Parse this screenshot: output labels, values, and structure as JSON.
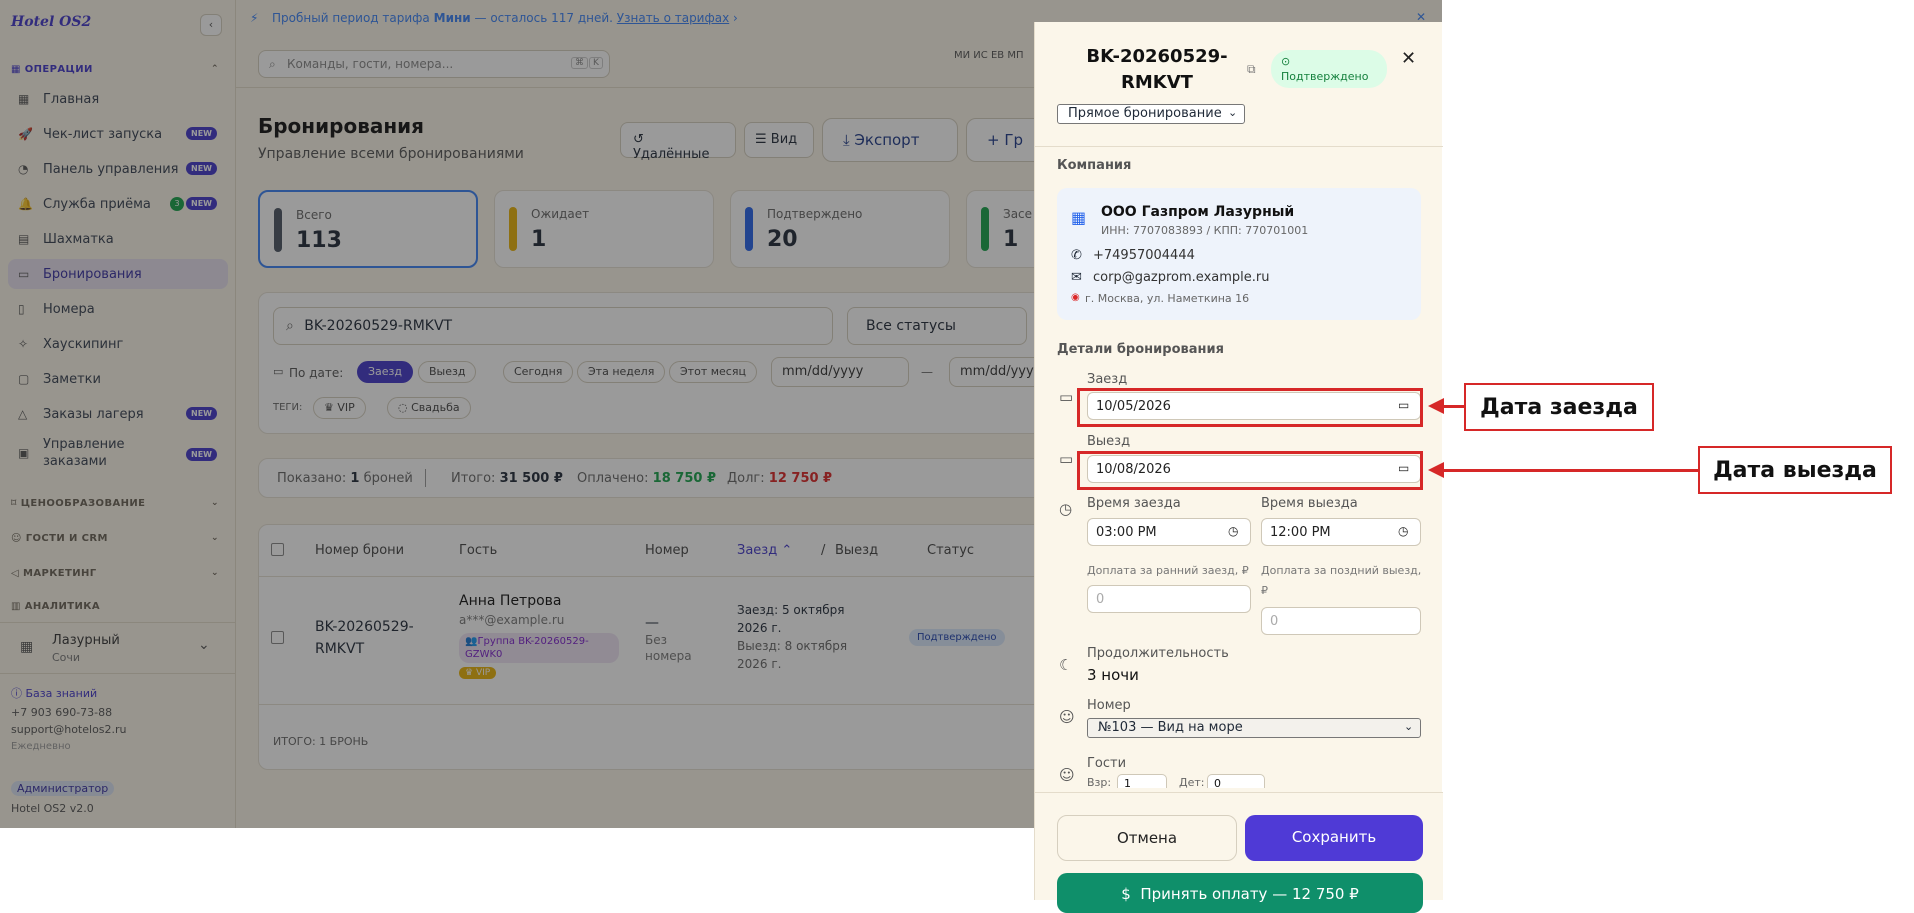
{
  "brand": "Hotel OS2",
  "trial": {
    "text_pre": "Пробный период тарифа",
    "plan": "Мини",
    "text_post": "— осталось 117 дней.",
    "link": "Узнать о тарифах"
  },
  "search": {
    "placeholder": "Команды, гости, номера...",
    "kbd1": "⌘",
    "kbd2": "K"
  },
  "avatars": [
    "МИ",
    "ИС",
    "ЕВ",
    "МП"
  ],
  "sidebar": {
    "section_ops": "ОПЕРАЦИИ",
    "items": [
      {
        "label": "Главная",
        "icon": "grid-icon"
      },
      {
        "label": "Чек-лист запуска",
        "icon": "rocket-icon",
        "new": "NEW"
      },
      {
        "label": "Панель управления",
        "icon": "gauge-icon",
        "new": "NEW"
      },
      {
        "label": "Служба приёма",
        "icon": "bell-icon",
        "count": "3",
        "new": "NEW"
      },
      {
        "label": "Шахматка",
        "icon": "table-icon"
      },
      {
        "label": "Бронирования",
        "icon": "calendar-icon"
      },
      {
        "label": "Номера",
        "icon": "door-icon"
      },
      {
        "label": "Хаускипинг",
        "icon": "sparkle-icon"
      },
      {
        "label": "Заметки",
        "icon": "note-icon"
      },
      {
        "label": "Заказы лагеря",
        "icon": "tent-icon",
        "new": "NEW"
      },
      {
        "label": "Управление",
        "label2": "заказами",
        "icon": "orders-icon",
        "new": "NEW"
      }
    ],
    "section_pricing": "ЦЕНООБРАЗОВАНИЕ",
    "section_guests": "ГОСТИ И CRM",
    "section_marketing": "МАРКЕТИНГ",
    "section_analytics": "АНАЛИТИКА",
    "hotel_name": "Лазурный",
    "hotel_city": "Сочи",
    "kb": "База знаний",
    "phone": "+7 903 690-73-88",
    "email": "support@hotelos2.ru",
    "daily": "Ежедневно",
    "role": "Администратор",
    "version": "Hotel OS2 v2.0"
  },
  "page": {
    "title": "Бронирования",
    "subtitle": "Управление всеми бронированиями",
    "btn_deleted": "Удалённые",
    "btn_view": "Вид",
    "btn_export": "Экспорт",
    "btn_group": "Гр"
  },
  "stats": [
    {
      "label": "Всего",
      "value": "113",
      "color": "#4b5563"
    },
    {
      "label": "Ожидает",
      "value": "1",
      "color": "#eab308"
    },
    {
      "label": "Подтверждено",
      "value": "20",
      "color": "#2563eb"
    },
    {
      "label": "Засе",
      "value": "1",
      "color": "#16a34a"
    }
  ],
  "filters": {
    "search_value": "BK-20260529-RMKVT",
    "status": "Все статусы",
    "by_date": "По дате:",
    "checkin": "Заезд",
    "checkout": "Выезд",
    "today": "Сегодня",
    "week": "Эта неделя",
    "month": "Этот месяц",
    "date_ph": "mm/dd/yyyy",
    "dash": "—",
    "tags": "ТЕГИ:",
    "tag_vip": "VIP",
    "tag_wedding": "Свадьба"
  },
  "summary": {
    "shown_pre": "Показано:",
    "shown_n": "1",
    "shown_post": "броней",
    "total_lbl": "Итого:",
    "total": "31 500 ₽",
    "paid_lbl": "Оплачено:",
    "paid": "18 750 ₽",
    "debt_lbl": "Долг:",
    "debt": "12 750 ₽"
  },
  "table": {
    "headers": {
      "num": "Номер брони",
      "guest": "Гость",
      "room": "Номер",
      "checkin": "Заезд",
      "slash": "/",
      "checkout": "Выезд",
      "status": "Статус"
    },
    "row": {
      "num1": "BK-20260529-",
      "num2": "RMKVT",
      "guest": "Анна Петрова",
      "email": "a***@example.ru",
      "group1": "Группа BK-20260529-",
      "group2": "GZWK0",
      "vip": "VIP",
      "room1": "—",
      "room2": "Без",
      "room3": "номера",
      "in1": "Заезд: 5 октября",
      "in2": "2026 г.",
      "out1": "Выезд: 8 октября",
      "out2": "2026 г.",
      "status": "Подтверждено"
    },
    "total": "ИТОГО: 1 БРОНЬ"
  },
  "drawer": {
    "title1": "BK-20260529-",
    "title2": "RMKVT",
    "status": "Подтверждено",
    "source": "Прямое бронирование",
    "company_section": "Компания",
    "company_name": "ООО Газпром Лазурный",
    "company_ids": "ИНН: 7707083893 / КПП: 770701001",
    "company_phone": "+74957004444",
    "company_email": "corp@gazprom.example.ru",
    "company_addr": "г. Москва, ул. Наметкина 16",
    "details_section": "Детали бронирования",
    "checkin_label": "Заезд",
    "checkin_value": "10/05/2026",
    "checkout_label": "Выезд",
    "checkout_value": "10/08/2026",
    "time_in_label": "Время заезда",
    "time_in": "03:00 PM",
    "time_out_label": "Время выезда",
    "time_out": "12:00 PM",
    "early_label": "Доплата за ранний заезд, ₽",
    "late_label1": "Доплата за поздний выезд,",
    "late_label2": "₽",
    "early_ph": "0",
    "late_ph": "0",
    "duration_label": "Продолжительность",
    "duration": "3 ночи",
    "room_label": "Номер",
    "room_value": "№103 — Вид на море",
    "guests_label": "Гости",
    "adults_lbl": "Взр:",
    "adults": "1",
    "kids_lbl": "Дет:",
    "kids": "0",
    "cancel": "Отмена",
    "save": "Сохранить",
    "pay": "Принять оплату — 12 750 ₽"
  },
  "annotations": {
    "checkin": "Дата заезда",
    "checkout": "Дата выезда"
  }
}
